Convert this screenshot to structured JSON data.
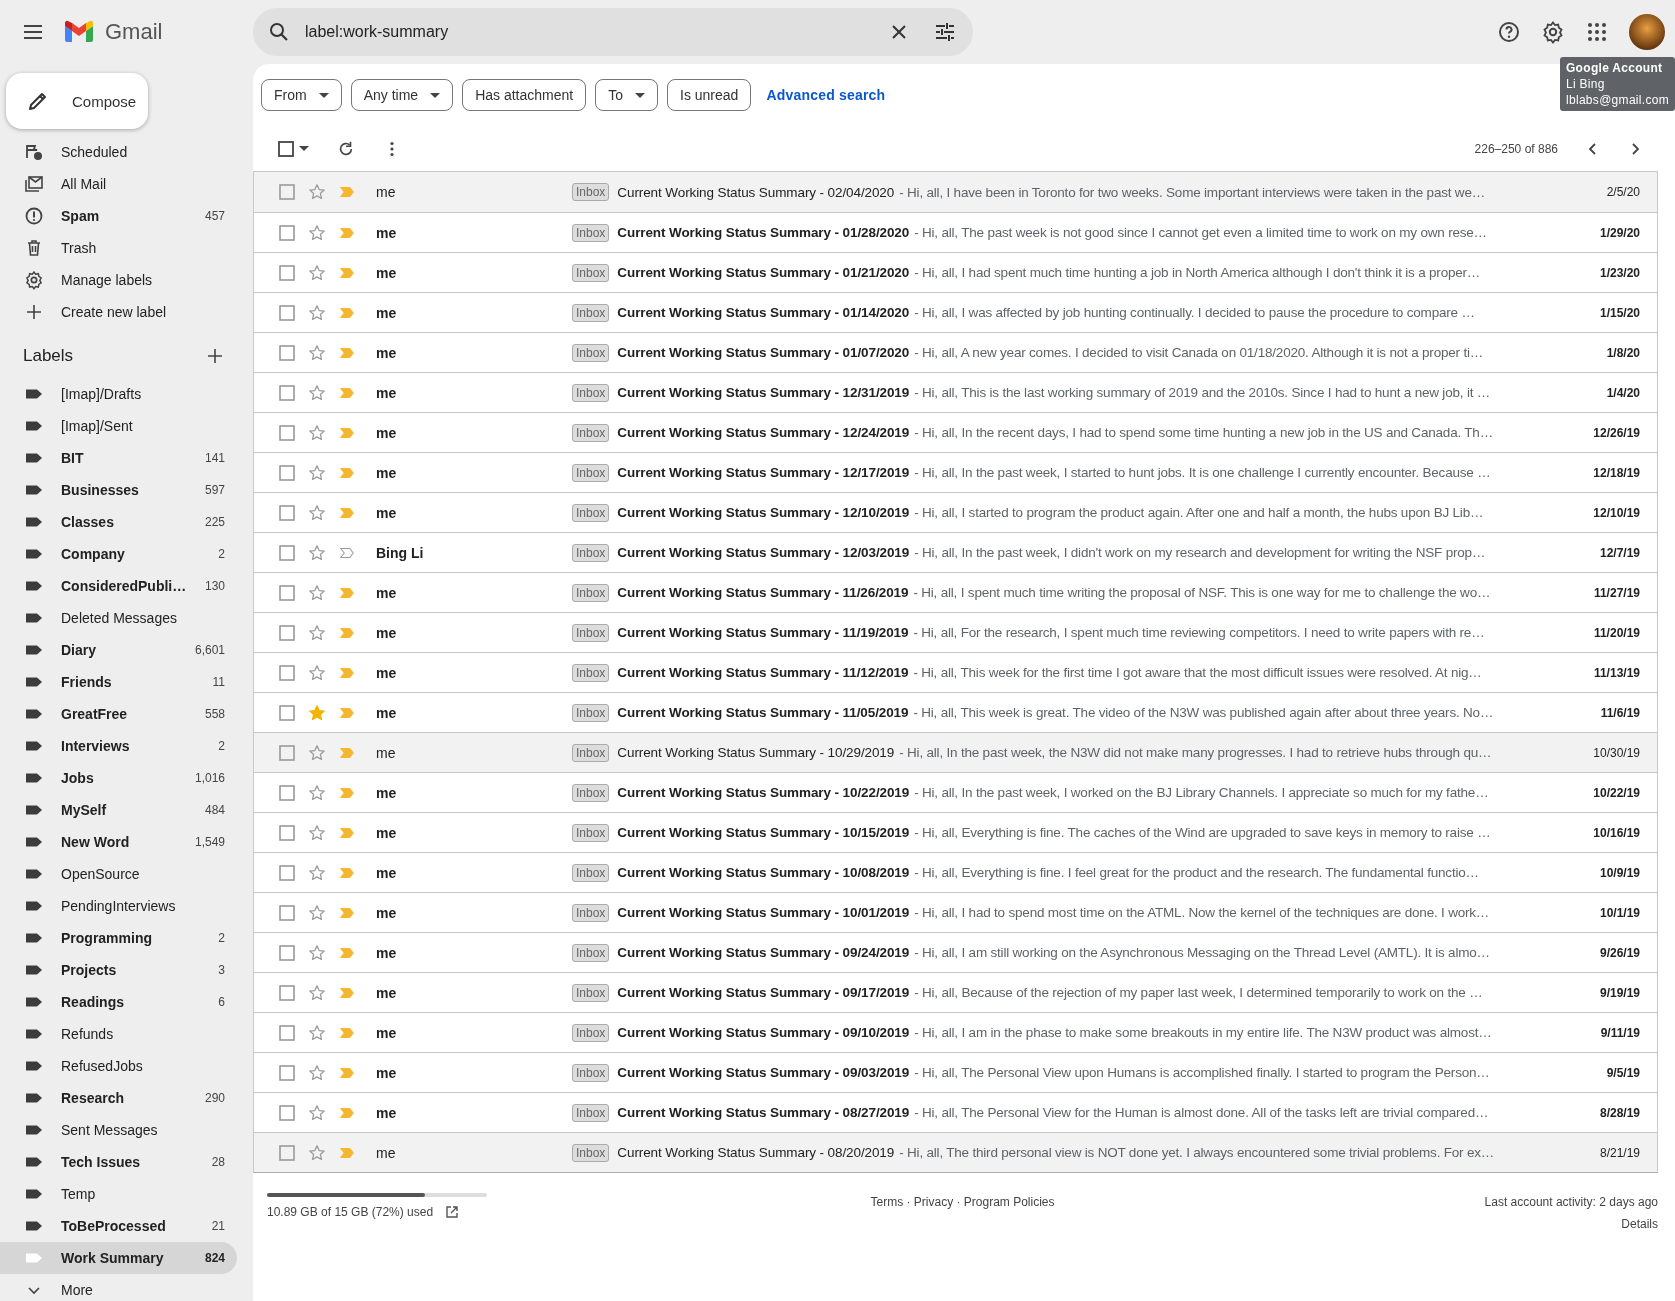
{
  "app": {
    "name": "Gmail"
  },
  "compose": {
    "label": "Compose"
  },
  "sidebar": {
    "nav": [
      {
        "label": "Scheduled",
        "kind": "scheduled",
        "unread": false,
        "selected": false
      },
      {
        "label": "All Mail",
        "kind": "allmail",
        "unread": false,
        "selected": false
      },
      {
        "label": "Spam",
        "kind": "spam",
        "count": "457",
        "unread": true,
        "selected": false
      },
      {
        "label": "Trash",
        "kind": "trash",
        "unread": false,
        "selected": false
      },
      {
        "label": "Manage labels",
        "kind": "manage",
        "unread": false,
        "selected": false
      },
      {
        "label": "Create new label",
        "kind": "create",
        "unread": false,
        "selected": false
      }
    ],
    "labels_title": "Labels",
    "labels": [
      {
        "label": "[Imap]/Drafts",
        "unread": false,
        "selected": false
      },
      {
        "label": "[Imap]/Sent",
        "unread": false,
        "selected": false
      },
      {
        "label": "BIT",
        "count": "141",
        "unread": true,
        "selected": false
      },
      {
        "label": "Businesses",
        "count": "597",
        "unread": true,
        "selected": false
      },
      {
        "label": "Classes",
        "count": "225",
        "unread": true,
        "selected": false
      },
      {
        "label": "Company",
        "count": "2",
        "unread": true,
        "selected": false
      },
      {
        "label": "ConsideredPubli…",
        "count": "130",
        "unread": true,
        "selected": false
      },
      {
        "label": "Deleted Messages",
        "unread": false,
        "selected": false
      },
      {
        "label": "Diary",
        "count": "6,601",
        "unread": true,
        "selected": false
      },
      {
        "label": "Friends",
        "count": "11",
        "unread": true,
        "selected": false
      },
      {
        "label": "GreatFree",
        "count": "558",
        "unread": true,
        "selected": false
      },
      {
        "label": "Interviews",
        "count": "2",
        "unread": true,
        "selected": false
      },
      {
        "label": "Jobs",
        "count": "1,016",
        "unread": true,
        "selected": false
      },
      {
        "label": "MySelf",
        "count": "484",
        "unread": true,
        "selected": false
      },
      {
        "label": "New Word",
        "count": "1,549",
        "unread": true,
        "selected": false
      },
      {
        "label": "OpenSource",
        "unread": false,
        "selected": false
      },
      {
        "label": "PendingInterviews",
        "unread": false,
        "selected": false
      },
      {
        "label": "Programming",
        "count": "2",
        "unread": true,
        "selected": false
      },
      {
        "label": "Projects",
        "count": "3",
        "unread": true,
        "selected": false
      },
      {
        "label": "Readings",
        "count": "6",
        "unread": true,
        "selected": false
      },
      {
        "label": "Refunds",
        "unread": false,
        "selected": false
      },
      {
        "label": "RefusedJobs",
        "unread": false,
        "selected": false
      },
      {
        "label": "Research",
        "count": "290",
        "unread": true,
        "selected": false
      },
      {
        "label": "Sent Messages",
        "unread": false,
        "selected": false
      },
      {
        "label": "Tech Issues",
        "count": "28",
        "unread": true,
        "selected": false
      },
      {
        "label": "Temp",
        "unread": false,
        "selected": false
      },
      {
        "label": "ToBeProcessed",
        "count": "21",
        "unread": true,
        "selected": false
      },
      {
        "label": "Work Summary",
        "count": "824",
        "unread": true,
        "selected": true
      }
    ],
    "more": "More"
  },
  "search": {
    "value": "label:work-summary"
  },
  "filters": [
    {
      "label": "From",
      "dropdown": true
    },
    {
      "label": "Any time",
      "dropdown": true
    },
    {
      "label": "Has attachment",
      "dropdown": false
    },
    {
      "label": "To",
      "dropdown": true
    },
    {
      "label": "Is unread",
      "dropdown": false
    }
  ],
  "advanced_search": "Advanced search",
  "account_tooltip": {
    "title": "Google Account",
    "name": "Li Bing",
    "email": "lblabs@gmail.com"
  },
  "select_all": {
    "checked": false
  },
  "pagination": "226–250 of 886",
  "emails": [
    {
      "sender": "me",
      "badge": "Inbox",
      "subject": "Current Working Status Summary - 02/04/2020",
      "snippet": " - Hi, all, I have been in Toronto for two weeks. Some important interviews were taken in the past we…",
      "date": "2/5/20",
      "unread": false,
      "starred": false,
      "important": true
    },
    {
      "sender": "me",
      "badge": "Inbox",
      "subject": "Current Working Status Summary - 01/28/2020",
      "snippet": " - Hi, all, The past week is not good since I cannot get even a limited time to work on my own rese…",
      "date": "1/29/20",
      "unread": true,
      "starred": false,
      "important": true
    },
    {
      "sender": "me",
      "badge": "Inbox",
      "subject": "Current Working Status Summary - 01/21/2020",
      "snippet": " - Hi, all, I had spent much time hunting a job in North America although I don't think it is a proper…",
      "date": "1/23/20",
      "unread": true,
      "starred": false,
      "important": true
    },
    {
      "sender": "me",
      "badge": "Inbox",
      "subject": "Current Working Status Summary - 01/14/2020",
      "snippet": " - Hi, all, I was affected by job hunting continually. I decided to pause the procedure to compare …",
      "date": "1/15/20",
      "unread": true,
      "starred": false,
      "important": true
    },
    {
      "sender": "me",
      "badge": "Inbox",
      "subject": "Current Working Status Summary - 01/07/2020",
      "snippet": " - Hi, all, A new year comes. I decided to visit Canada on 01/18/2020. Although it is not a proper ti…",
      "date": "1/8/20",
      "unread": true,
      "starred": false,
      "important": true
    },
    {
      "sender": "me",
      "badge": "Inbox",
      "subject": "Current Working Status Summary - 12/31/2019",
      "snippet": " - Hi, all, This is the last working summary of 2019 and the 2010s. Since I had to hunt a new job, it …",
      "date": "1/4/20",
      "unread": true,
      "starred": false,
      "important": true
    },
    {
      "sender": "me",
      "badge": "Inbox",
      "subject": "Current Working Status Summary - 12/24/2019",
      "snippet": " - Hi, all, In the recent days, I had to spend some time hunting a new job in the US and Canada. Th…",
      "date": "12/26/19",
      "unread": true,
      "starred": false,
      "important": true
    },
    {
      "sender": "me",
      "badge": "Inbox",
      "subject": "Current Working Status Summary - 12/17/2019",
      "snippet": " - Hi, all, In the past week, I started to hunt jobs. It is one challenge I currently encounter. Because …",
      "date": "12/18/19",
      "unread": true,
      "starred": false,
      "important": true
    },
    {
      "sender": "me",
      "badge": "Inbox",
      "subject": "Current Working Status Summary - 12/10/2019",
      "snippet": " - Hi, all, I started to program the product again. After one and half a month, the hubs upon BJ Lib…",
      "date": "12/10/19",
      "unread": true,
      "starred": false,
      "important": true
    },
    {
      "sender": "Bing Li",
      "badge": "Inbox",
      "subject": "Current Working Status Summary - 12/03/2019",
      "snippet": " - Hi, all, In the past week, I didn't work on my research and development for writing the NSF prop…",
      "date": "12/7/19",
      "unread": true,
      "starred": false,
      "important": false
    },
    {
      "sender": "me",
      "badge": "Inbox",
      "subject": "Current Working Status Summary - 11/26/2019",
      "snippet": " - Hi, all, I spent much time writing the proposal of NSF. This is one way for me to challenge the wo…",
      "date": "11/27/19",
      "unread": true,
      "starred": false,
      "important": true
    },
    {
      "sender": "me",
      "badge": "Inbox",
      "subject": "Current Working Status Summary - 11/19/2019",
      "snippet": " - Hi, all, For the research, I spent much time reviewing competitors. I need to write papers with re…",
      "date": "11/20/19",
      "unread": true,
      "starred": false,
      "important": true
    },
    {
      "sender": "me",
      "badge": "Inbox",
      "subject": "Current Working Status Summary - 11/12/2019",
      "snippet": " - Hi, all, This week for the first time I got aware that the most difficult issues were resolved. At nig…",
      "date": "11/13/19",
      "unread": true,
      "starred": false,
      "important": true
    },
    {
      "sender": "me",
      "badge": "Inbox",
      "subject": "Current Working Status Summary - 11/05/2019",
      "snippet": " - Hi, all, This week is great. The video of the N3W was published again after about three years. No…",
      "date": "11/6/19",
      "unread": true,
      "starred": true,
      "important": true
    },
    {
      "sender": "me",
      "badge": "Inbox",
      "subject": "Current Working Status Summary - 10/29/2019",
      "snippet": " - Hi, all, In the past week, the N3W did not make many progresses. I had to retrieve hubs through qu…",
      "date": "10/30/19",
      "unread": false,
      "starred": false,
      "important": true
    },
    {
      "sender": "me",
      "badge": "Inbox",
      "subject": "Current Working Status Summary - 10/22/2019",
      "snippet": " - Hi, all, In the past week, I worked on the BJ Library Channels. I appreciate so much for my fathe…",
      "date": "10/22/19",
      "unread": true,
      "starred": false,
      "important": true
    },
    {
      "sender": "me",
      "badge": "Inbox",
      "subject": "Current Working Status Summary - 10/15/2019",
      "snippet": " - Hi, all, Everything is fine. The caches of the Wind are upgraded to save keys in memory to raise …",
      "date": "10/16/19",
      "unread": true,
      "starred": false,
      "important": true
    },
    {
      "sender": "me",
      "badge": "Inbox",
      "subject": "Current Working Status Summary - 10/08/2019",
      "snippet": " - Hi, all, Everything is fine. I feel great for the product and the research. The fundamental functio…",
      "date": "10/9/19",
      "unread": true,
      "starred": false,
      "important": true
    },
    {
      "sender": "me",
      "badge": "Inbox",
      "subject": "Current Working Status Summary - 10/01/2019",
      "snippet": " - Hi, all, I had to spend most time on the ATML. Now the kernel of the techniques are done. I work…",
      "date": "10/1/19",
      "unread": true,
      "starred": false,
      "important": true
    },
    {
      "sender": "me",
      "badge": "Inbox",
      "subject": "Current Working Status Summary - 09/24/2019",
      "snippet": " - Hi, all, I am still working on the Asynchronous Messaging on the Thread Level (AMTL). It is almo…",
      "date": "9/26/19",
      "unread": true,
      "starred": false,
      "important": true
    },
    {
      "sender": "me",
      "badge": "Inbox",
      "subject": "Current Working Status Summary - 09/17/2019",
      "snippet": " - Hi, all, Because of the rejection of my paper last week, I determined temporarily to work on the …",
      "date": "9/19/19",
      "unread": true,
      "starred": false,
      "important": true
    },
    {
      "sender": "me",
      "badge": "Inbox",
      "subject": "Current Working Status Summary - 09/10/2019",
      "snippet": " - Hi, all, I am in the phase to make some breakouts in my entire life. The N3W product was almost…",
      "date": "9/11/19",
      "unread": true,
      "starred": false,
      "important": true
    },
    {
      "sender": "me",
      "badge": "Inbox",
      "subject": "Current Working Status Summary - 09/03/2019",
      "snippet": " - Hi, all, The Personal View upon Humans is accomplished finally. I started to program the Person…",
      "date": "9/5/19",
      "unread": true,
      "starred": false,
      "important": true
    },
    {
      "sender": "me",
      "badge": "Inbox",
      "subject": "Current Working Status Summary - 08/27/2019",
      "snippet": " - Hi, all, The Personal View for the Human is almost done. All of the tasks left are trivial compared…",
      "date": "8/28/19",
      "unread": true,
      "starred": false,
      "important": true
    },
    {
      "sender": "me",
      "badge": "Inbox",
      "subject": "Current Working Status Summary - 08/20/2019",
      "snippet": " - Hi, all, The third personal view is NOT done yet. I always encountered some trivial problems. For ex…",
      "date": "8/21/19",
      "unread": false,
      "starred": false,
      "important": true
    }
  ],
  "footer": {
    "storage": {
      "level": 0.72,
      "text": "10.89 GB of 15 GB (72%) used"
    },
    "links": "Terms · Privacy · Program Policies",
    "activity": "Last account activity: 2 days ago",
    "details": "Details"
  }
}
